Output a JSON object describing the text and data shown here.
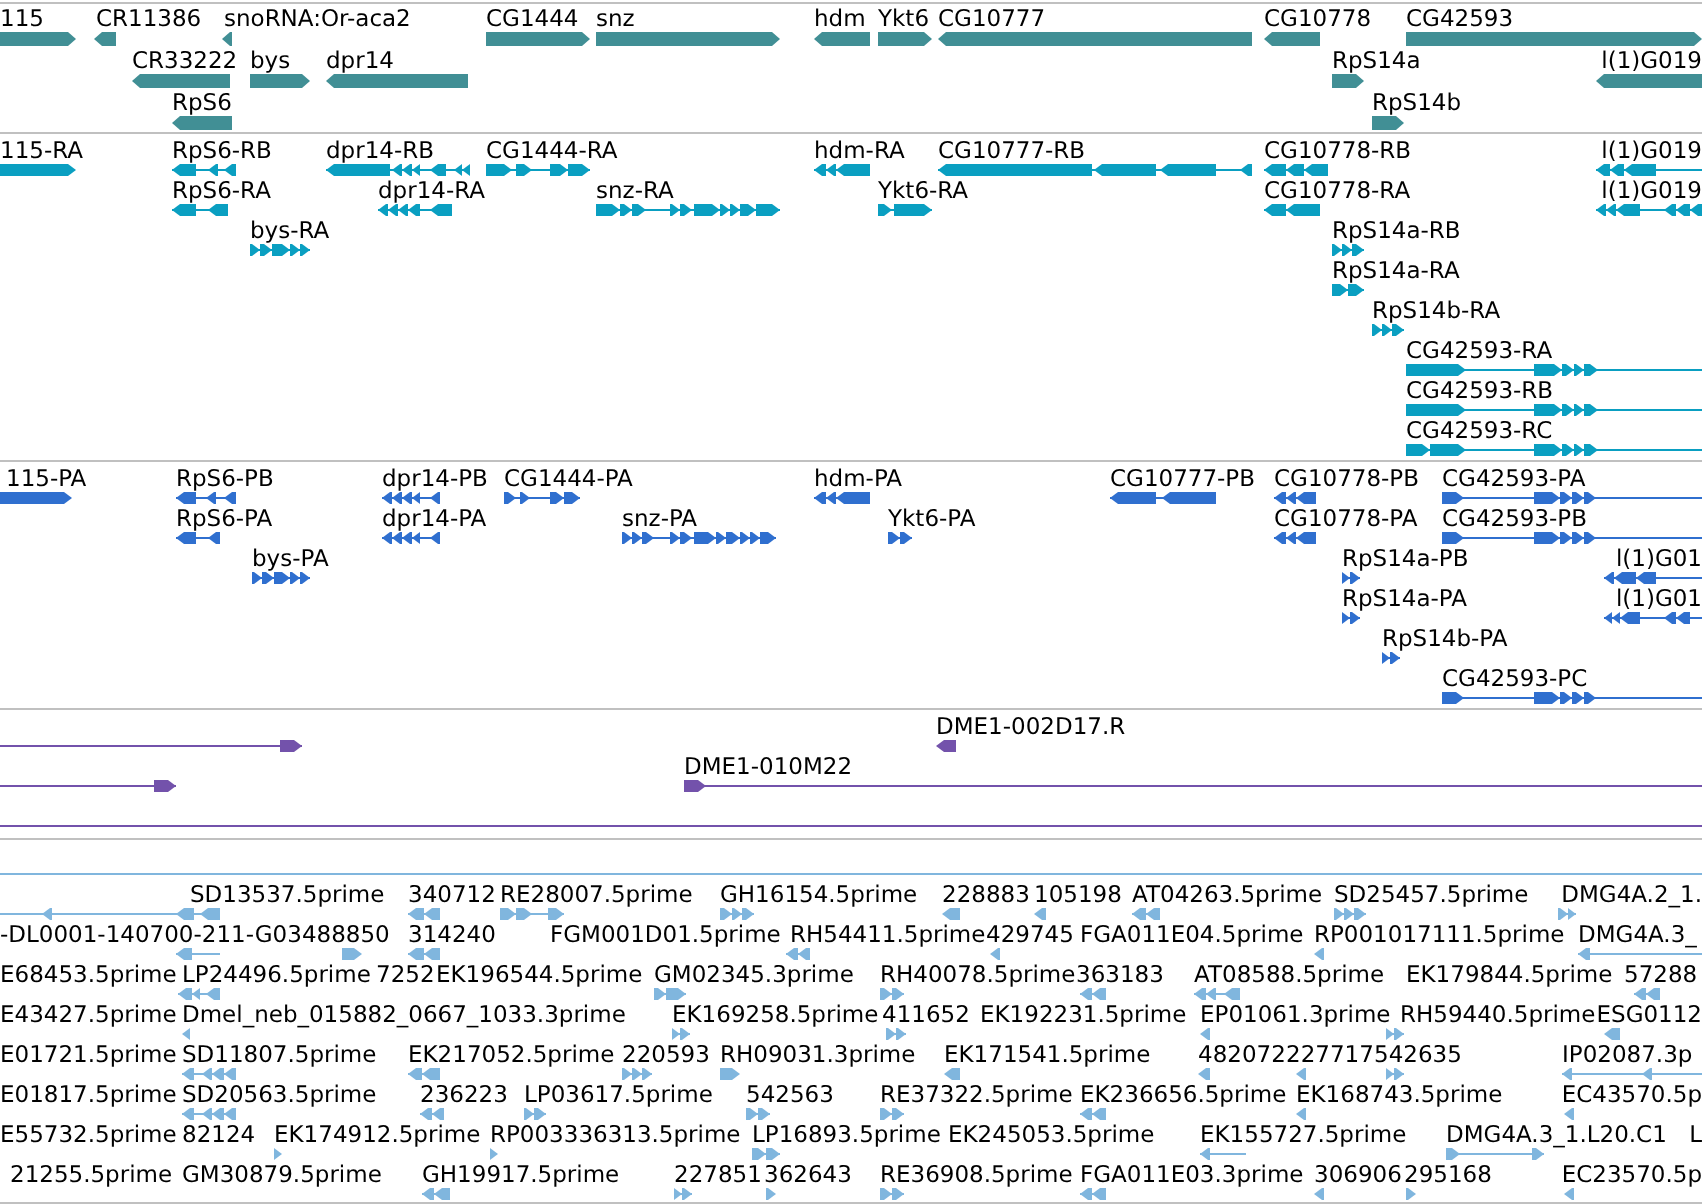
{
  "tracks": [
    {
      "color": "#418f95",
      "rows": [
        {
          "features": [
            {
              "label": "115",
              "reverse": false
            },
            {
              "label": "CR11386",
              "reverse": true
            },
            {
              "label": "snoRNA:Or-aca2",
              "reverse": true
            },
            {
              "label": "CG1444",
              "reverse": false
            },
            {
              "label": "snz",
              "reverse": false
            },
            {
              "label": "hdm",
              "reverse": true
            },
            {
              "label": "Ykt6",
              "reverse": false
            },
            {
              "label": "CG10777",
              "reverse": true
            },
            {
              "label": "CG10778",
              "reverse": true
            },
            {
              "label": "CG42593",
              "reverse": false
            }
          ]
        },
        {
          "features": [
            {
              "label": "CR33222",
              "reverse": true
            },
            {
              "label": "bys",
              "reverse": false
            },
            {
              "label": "dpr14",
              "reverse": true
            },
            {
              "label": "RpS14a",
              "reverse": false
            },
            {
              "label": "l(1)G019",
              "reverse": true
            }
          ]
        },
        {
          "features": [
            {
              "label": "RpS6",
              "reverse": true
            },
            {
              "label": "RpS14b",
              "reverse": false
            }
          ]
        }
      ]
    },
    {
      "color": "#0a9fc1",
      "rows": [
        {
          "features": [
            {
              "label": "115-RA",
              "reverse": false
            },
            {
              "label": "RpS6-RB",
              "reverse": true
            },
            {
              "label": "dpr14-RB",
              "reverse": true
            },
            {
              "label": "CG1444-RA",
              "reverse": false
            },
            {
              "label": "hdm-RA",
              "reverse": true
            },
            {
              "label": "CG10777-RB",
              "reverse": true
            },
            {
              "label": "CG10778-RB",
              "reverse": true
            },
            {
              "label": "l(1)G019",
              "reverse": true
            }
          ]
        },
        {
          "features": [
            {
              "label": "RpS6-RA",
              "reverse": true
            },
            {
              "label": "dpr14-RA",
              "reverse": true
            },
            {
              "label": "snz-RA",
              "reverse": false
            },
            {
              "label": "Ykt6-RA",
              "reverse": false
            },
            {
              "label": "CG10778-RA",
              "reverse": true
            },
            {
              "label": "l(1)G019",
              "reverse": true
            }
          ]
        },
        {
          "features": [
            {
              "label": "bys-RA",
              "reverse": false
            },
            {
              "label": "RpS14a-RB",
              "reverse": false
            }
          ]
        },
        {
          "features": [
            {
              "label": "RpS14a-RA",
              "reverse": false
            }
          ]
        },
        {
          "features": [
            {
              "label": "RpS14b-RA",
              "reverse": false
            }
          ]
        },
        {
          "features": [
            {
              "label": "CG42593-RA",
              "reverse": false
            }
          ]
        },
        {
          "features": [
            {
              "label": "CG42593-RB",
              "reverse": false
            }
          ]
        },
        {
          "features": [
            {
              "label": "CG42593-RC",
              "reverse": false
            }
          ]
        }
      ]
    },
    {
      "color": "#2f6fcf",
      "rows": [
        {
          "features": [
            {
              "label": "115-PA",
              "reverse": false
            },
            {
              "label": "RpS6-PB",
              "reverse": true
            },
            {
              "label": "dpr14-PB",
              "reverse": true
            },
            {
              "label": "CG1444-PA",
              "reverse": false
            },
            {
              "label": "hdm-PA",
              "reverse": true
            },
            {
              "label": "CG10777-PB",
              "reverse": true
            },
            {
              "label": "CG10778-PB",
              "reverse": true
            },
            {
              "label": "CG42593-PA",
              "reverse": false
            }
          ]
        },
        {
          "features": [
            {
              "label": "RpS6-PA",
              "reverse": true
            },
            {
              "label": "dpr14-PA",
              "reverse": true
            },
            {
              "label": "snz-PA",
              "reverse": false
            },
            {
              "label": "Ykt6-PA",
              "reverse": false
            },
            {
              "label": "CG10778-PA",
              "reverse": true
            },
            {
              "label": "CG42593-PB",
              "reverse": false
            }
          ]
        },
        {
          "features": [
            {
              "label": "bys-PA",
              "reverse": false
            },
            {
              "label": "RpS14a-PB",
              "reverse": false
            },
            {
              "label": "l(1)G01",
              "reverse": true
            }
          ]
        },
        {
          "features": [
            {
              "label": "RpS14a-PA",
              "reverse": false
            },
            {
              "label": "l(1)G01",
              "reverse": true
            }
          ]
        },
        {
          "features": [
            {
              "label": "RpS14b-PA",
              "reverse": false
            }
          ]
        },
        {
          "features": [
            {
              "label": "CG42593-PC",
              "reverse": false
            }
          ]
        }
      ]
    },
    {
      "color": "#7352ab",
      "rows": [
        {
          "features": [
            {
              "reverse": false
            },
            {
              "label": "DME1-002D17.R",
              "reverse": true
            }
          ]
        },
        {
          "features": [
            {
              "reverse": false
            },
            {
              "label": "DME1-010M22",
              "reverse": false
            }
          ]
        },
        {
          "features": [
            {
              "kind": "line"
            }
          ]
        }
      ]
    },
    {
      "color": "#80b6de",
      "rows": [
        {
          "features": [
            {
              "kind": "line"
            }
          ]
        },
        {
          "features": [
            {
              "label": "SD13537.5prime",
              "reverse": true
            },
            {
              "label": "340712",
              "reverse": true
            },
            {
              "label": "RE28007.5prime",
              "reverse": false
            },
            {
              "label": "GH16154.5prime",
              "reverse": false
            },
            {
              "label": "228883",
              "reverse": true
            },
            {
              "label": "105198",
              "reverse": true
            },
            {
              "label": "AT04263.5prime",
              "reverse": true
            },
            {
              "label": "SD25457.5prime",
              "reverse": false
            },
            {
              "label": "DMG4A.2_1.",
              "reverse": false
            }
          ]
        },
        {
          "features": [
            {
              "label": "-DL0001-140700-211-G03488850",
              "reverse": true
            },
            {
              "reverse": false
            },
            {
              "label": "314240",
              "reverse": true
            },
            {
              "label": "FGM001D01.5prime"
            },
            {
              "label": "RH54411.5prime",
              "reverse": true
            },
            {
              "label": "429745",
              "reverse": true
            },
            {
              "label": "FGA011E04.5prime"
            },
            {
              "label": "RP001017111.5prime",
              "reverse": true
            },
            {
              "label": "DMG4A.3_",
              "reverse": true
            }
          ]
        },
        {
          "features": [
            {
              "label": "E68453.5prime"
            },
            {
              "label": "LP24496.5prime",
              "reverse": true
            },
            {
              "label": "7252"
            },
            {
              "label": "EK196544.5prime"
            },
            {
              "label": "GM02345.3prime",
              "reverse": false
            },
            {
              "label": "RH40078.5prime",
              "reverse": false
            },
            {
              "label": "363183",
              "reverse": true
            },
            {
              "label": "AT08588.5prime",
              "reverse": true
            },
            {
              "label": "EK179844.5prime"
            },
            {
              "label": "57288",
              "reverse": true
            }
          ]
        },
        {
          "features": [
            {
              "label": "E43427.5prime"
            },
            {
              "label": "Dmel_neb_015882_0667_1033.3prime",
              "reverse": true
            },
            {
              "label": "EK169258.5prime",
              "reverse": false
            },
            {
              "label": "411652",
              "reverse": false
            },
            {
              "label": "EK192231.5prime"
            },
            {
              "label": "EP01061.3prime",
              "reverse": true
            },
            {
              "label": "RH59440.5prime",
              "reverse": false
            },
            {
              "label": "ESG0112",
              "reverse": true
            }
          ]
        },
        {
          "features": [
            {
              "label": "E01721.5prime"
            },
            {
              "label": "SD11807.5prime",
              "reverse": true
            },
            {
              "label": "EK217052.5prime",
              "reverse": true
            },
            {
              "label": "220593",
              "reverse": false
            },
            {
              "label": "RH09031.3prime",
              "reverse": false
            },
            {
              "label": "EK171541.5prime",
              "reverse": true
            },
            {
              "label": "482072",
              "reverse": true
            },
            {
              "label": "227717",
              "reverse": true
            },
            {
              "label": "542635",
              "reverse": false
            },
            {
              "label": "IP02087.3p",
              "reverse": true
            }
          ]
        },
        {
          "features": [
            {
              "label": "E01817.5prime"
            },
            {
              "label": "SD20563.5prime",
              "reverse": true
            },
            {
              "label": "236223",
              "reverse": true
            },
            {
              "label": "LP03617.5prime",
              "reverse": false
            },
            {
              "label": "542563",
              "reverse": false
            },
            {
              "label": "RE37322.5prime",
              "reverse": false
            },
            {
              "label": "EK236656.5prime",
              "reverse": true
            },
            {
              "label": "EK168743.5prime",
              "reverse": true
            },
            {
              "label": "EC43570.5p",
              "reverse": true
            }
          ]
        },
        {
          "features": [
            {
              "label": "E55732.5prime"
            },
            {
              "label": "82124"
            },
            {
              "label": "EK174912.5prime",
              "reverse": false
            },
            {
              "label": "RP003336313.5prime",
              "reverse": false
            },
            {
              "label": "LP16893.5prime",
              "reverse": false
            },
            {
              "label": "EK245053.5prime"
            },
            {
              "label": "EK155727.5prime",
              "reverse": true
            },
            {
              "label": "DMG4A.3_1.L20.C1",
              "reverse": false
            },
            {
              "label": "L"
            }
          ]
        },
        {
          "features": [
            {
              "label": "21255.5prime"
            },
            {
              "label": "GM30879.5prime"
            },
            {
              "label": "GH19917.5prime",
              "reverse": true
            },
            {
              "label": "227851",
              "reverse": false
            },
            {
              "label": "362643",
              "reverse": false
            },
            {
              "label": "RE36908.5prime",
              "reverse": false
            },
            {
              "label": "FGA011E03.3prime",
              "reverse": true
            },
            {
              "label": "306906",
              "reverse": true
            },
            {
              "label": "295168",
              "reverse": false
            },
            {
              "label": "EC23570.5p",
              "reverse": true
            }
          ]
        }
      ]
    }
  ]
}
